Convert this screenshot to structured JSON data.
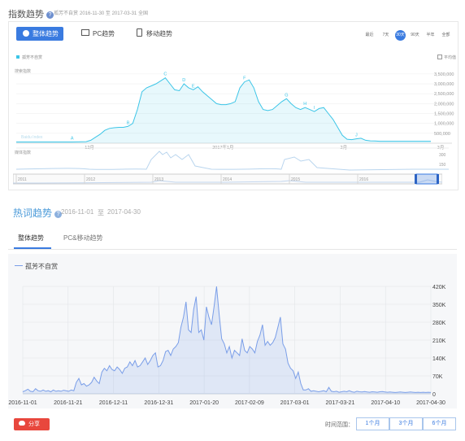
{
  "header": {
    "title": "指数趋势",
    "keyword": "孤芳不自赏",
    "date_range": "2016-11-30 至 2017-03-31",
    "region": "全国"
  },
  "tabs": [
    {
      "label": "整体趋势",
      "active": true,
      "icon": "pie-chart-icon"
    },
    {
      "label": "PC趋势",
      "active": false,
      "icon": "monitor-icon"
    },
    {
      "label": "移动趋势",
      "active": false,
      "icon": "mobile-icon"
    }
  ],
  "ranges": [
    {
      "label": "最近",
      "active": false
    },
    {
      "label": "7天",
      "active": false
    },
    {
      "label": "30天",
      "active": true
    },
    {
      "label": "90天",
      "active": false
    },
    {
      "label": "半年",
      "active": false
    },
    {
      "label": "全部",
      "active": false
    }
  ],
  "legend": {
    "series": "孤芳不自赏",
    "avg_label": "平均值"
  },
  "colors": {
    "accent": "#3a7be0",
    "series1": "#3cc5e7",
    "series2": "#7a9ee8",
    "share": "#e8473d"
  },
  "chart_data": [
    {
      "type": "area",
      "ylabel": "搜索指数",
      "y_ticks": [
        "500,000",
        "1,000,000",
        "1,500,000",
        "2,000,000",
        "2,500,000",
        "3,000,000",
        "3,500,000"
      ],
      "ylim": [
        0,
        3700000
      ],
      "x_ticks": [
        "12月",
        "2017年1月",
        "2月",
        "3月"
      ],
      "annotations": [
        "A",
        "B",
        "C",
        "D",
        "E",
        "F",
        "G",
        "H",
        "I",
        "J"
      ],
      "watermark": "Baidu Index",
      "values": [
        60000,
        60000,
        60000,
        60000,
        60000,
        60000,
        60000,
        60000,
        60000,
        60000,
        60000,
        60000,
        60000,
        65000,
        70000,
        80000,
        150000,
        300000,
        450000,
        650000,
        750000,
        780000,
        800000,
        800000,
        850000,
        1000000,
        1700000,
        2600000,
        2800000,
        2900000,
        3000000,
        3150000,
        3300000,
        3000000,
        2700000,
        2650000,
        3000000,
        2800000,
        2700000,
        2850000,
        2600000,
        2400000,
        2200000,
        2000000,
        1950000,
        1950000,
        2000000,
        2100000,
        2800000,
        3100000,
        3200000,
        2800000,
        2100000,
        1700000,
        1650000,
        1700000,
        1900000,
        2100000,
        2250000,
        2000000,
        1800000,
        1700000,
        1800000,
        1700000,
        1600000,
        1750000,
        1800000,
        1500000,
        1200000,
        800000,
        400000,
        200000,
        180000,
        220000,
        250000,
        150000,
        120000,
        110000,
        100000,
        100000,
        100000,
        100000,
        100000,
        100000,
        100000,
        100000,
        100000,
        100000,
        100000,
        100000
      ]
    },
    {
      "type": "line",
      "title": "",
      "ylabel": "媒体指数",
      "y_ticks": [
        "150",
        "300"
      ],
      "x_ticks": [
        "2011",
        "2012",
        "2013",
        "2014",
        "2015",
        "2016"
      ]
    },
    {
      "type": "area",
      "series": [
        {
          "name": "孤芳不自赏"
        }
      ],
      "y_ticks": [
        "0",
        "70K",
        "140K",
        "210K",
        "280K",
        "350K",
        "420K"
      ],
      "ylim": [
        0,
        420000
      ],
      "x_ticks": [
        "2016-11-01",
        "2016-11-21",
        "2016-12-11",
        "2016-12-31",
        "2017-01-20",
        "2017-02-09",
        "2017-03-01",
        "2017-03-21",
        "2017-04-10",
        "2017-04-30"
      ],
      "values": [
        8000,
        12000,
        18000,
        10000,
        8000,
        20000,
        12000,
        10000,
        15000,
        10000,
        12000,
        8000,
        15000,
        10000,
        12000,
        10000,
        14000,
        12000,
        10000,
        15000,
        12000,
        45000,
        60000,
        35000,
        40000,
        30000,
        35000,
        45000,
        65000,
        50000,
        40000,
        85000,
        100000,
        90000,
        110000,
        95000,
        90000,
        105000,
        95000,
        80000,
        100000,
        105000,
        125000,
        110000,
        130000,
        105000,
        110000,
        125000,
        140000,
        115000,
        130000,
        150000,
        160000,
        105000,
        110000,
        130000,
        165000,
        170000,
        150000,
        175000,
        185000,
        200000,
        260000,
        300000,
        360000,
        250000,
        240000,
        330000,
        380000,
        240000,
        250000,
        210000,
        340000,
        300000,
        270000,
        340000,
        420000,
        310000,
        215000,
        195000,
        160000,
        185000,
        140000,
        170000,
        160000,
        150000,
        215000,
        170000,
        160000,
        185000,
        175000,
        160000,
        205000,
        230000,
        270000,
        190000,
        205000,
        190000,
        200000,
        220000,
        260000,
        300000,
        195000,
        175000,
        120000,
        100000,
        90000,
        60000,
        85000,
        40000,
        15000,
        15000,
        20000,
        10000,
        12000,
        10000,
        8000,
        10000,
        12000,
        8000,
        25000,
        10000,
        8000,
        10000,
        6000,
        8000,
        10000,
        8000,
        12000,
        8000,
        6000,
        10000,
        8000,
        7000,
        9000,
        7000,
        6000,
        8000,
        7000,
        6000,
        8000,
        9000,
        7000,
        6000,
        7000,
        6000,
        5000,
        6000,
        7000,
        6000,
        5000,
        6000,
        7000,
        6000,
        5000,
        6000,
        5000,
        6000,
        5000,
        6000,
        5000
      ]
    }
  ],
  "section2": {
    "title": "热词趋势",
    "date_from": "2016-11-01",
    "date_sep": "至",
    "date_to": "2017-04-30",
    "tabs": [
      "整体趋势",
      "PC&移动趋势"
    ]
  },
  "footer": {
    "share_label": "分享",
    "time_range_label": "时间范围：",
    "range_buttons": [
      "1个月",
      "3个月",
      "6个月"
    ]
  }
}
